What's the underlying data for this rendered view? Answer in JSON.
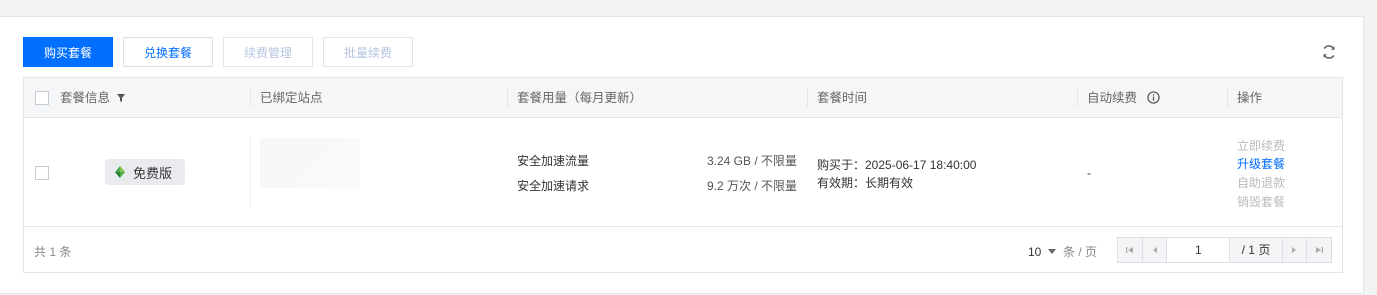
{
  "toolbar": {
    "buy_label": "购买套餐",
    "exchange_label": "兑换套餐",
    "renew_manage_label": "续费管理",
    "batch_renew_label": "批量续费",
    "refresh_icon": "refresh-icon"
  },
  "table": {
    "headers": {
      "package_info": "套餐信息",
      "bound_sites": "已绑定站点",
      "package_usage": "套餐用量（每月更新）",
      "package_time": "套餐时间",
      "auto_renew": "自动续费",
      "actions": "操作"
    },
    "row": {
      "plan_badge": "免费版",
      "usage": [
        {
          "label": "安全加速流量",
          "value": "3.24 GB / 不限量"
        },
        {
          "label": "安全加速请求",
          "value": "9.2 万次 / 不限量"
        }
      ],
      "purchase_time": "购买于：2025-06-17 18:40:00",
      "validity": "有效期：长期有效",
      "auto_renew": "-",
      "actions": {
        "renew_now": "立即续费",
        "upgrade": "升级套餐",
        "auto_refund": "自助退款",
        "destroy": "销毁套餐"
      }
    }
  },
  "footer": {
    "total": "共 1 条",
    "page_size": "10",
    "page_size_unit": "条 / 页",
    "current_page": "1",
    "total_pages": "/ 1 页"
  },
  "colors": {
    "primary": "#006eff",
    "disabled_text": "#b5c4df"
  }
}
